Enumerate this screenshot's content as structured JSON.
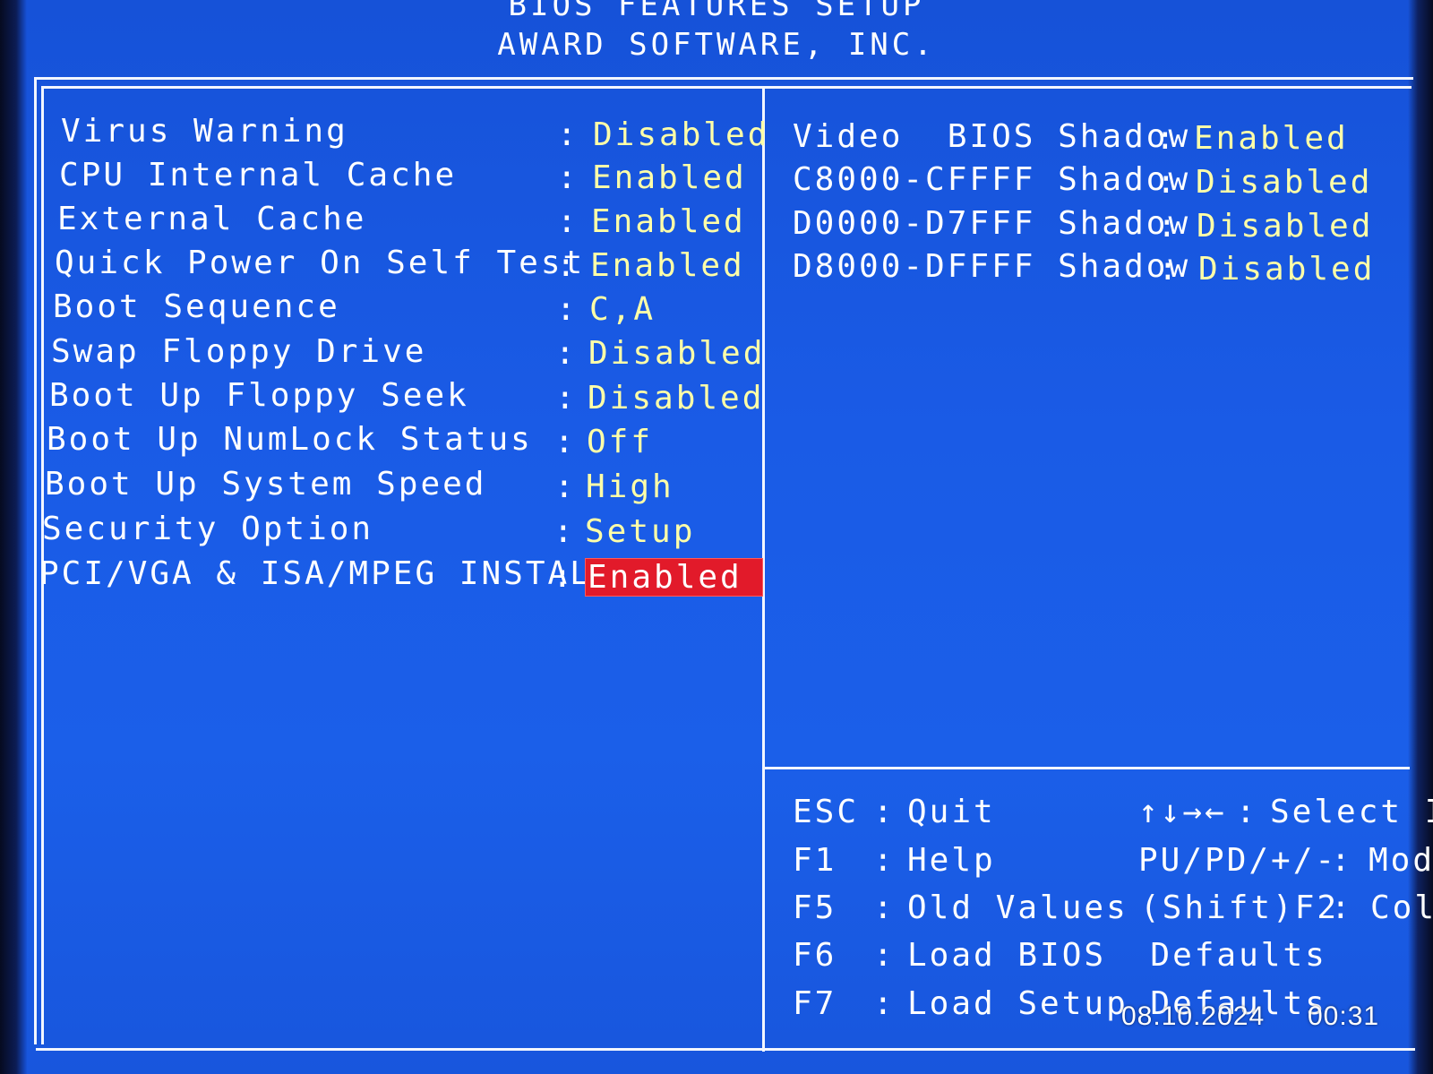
{
  "header": {
    "title_line1": "BIOS FEATURES SETUP",
    "title_line2": "AWARD SOFTWARE, INC."
  },
  "left_settings": [
    {
      "label": "Virus Warning",
      "value": "Disabled"
    },
    {
      "label": "CPU Internal Cache",
      "value": "Enabled"
    },
    {
      "label": "External Cache",
      "value": "Enabled"
    },
    {
      "label": "Quick Power On Self Test",
      "value": "Enabled"
    },
    {
      "label": "Boot Sequence",
      "value": "C,A"
    },
    {
      "label": "Swap Floppy Drive",
      "value": "Disabled"
    },
    {
      "label": "Boot Up Floppy Seek",
      "value": "Disabled"
    },
    {
      "label": "Boot Up NumLock Status",
      "value": "Off"
    },
    {
      "label": "Boot Up System Speed",
      "value": "High"
    },
    {
      "label": "Security Option",
      "value": "Setup"
    },
    {
      "label": "PCI/VGA & ISA/MPEG INSTALL",
      "value": "Enabled",
      "selected": true
    }
  ],
  "right_settings": [
    {
      "label": "Video  BIOS Shadow",
      "value": "Enabled"
    },
    {
      "label": "C8000-CFFFF Shadow",
      "value": "Disabled"
    },
    {
      "label": "D0000-D7FFF Shadow",
      "value": "Disabled"
    },
    {
      "label": "D8000-DFFFF Shadow",
      "value": "Disabled"
    }
  ],
  "separator": ":",
  "help_keys": [
    {
      "key": "ESC",
      "action": "Quit"
    },
    {
      "key": "F1",
      "action": "Help"
    },
    {
      "key": "F5",
      "action": "Old Values"
    },
    {
      "key": "F6",
      "action": "Load BIOS  Defaults"
    },
    {
      "key": "F7",
      "action": "Load Setup Defaults"
    }
  ],
  "help_keys_right": [
    {
      "key": "↑↓→←",
      "action": "Select It"
    },
    {
      "key": "PU/PD/+/-",
      "action": "Mod"
    },
    {
      "key": "(Shift)F2",
      "action": "Col"
    }
  ],
  "photo_stamp": {
    "date": "08.10.2024",
    "time": "00:31"
  },
  "colors": {
    "background": "#1b5fe9",
    "label": "#ffffff",
    "value": "#ffffa8",
    "selection": "#e21a2a"
  }
}
